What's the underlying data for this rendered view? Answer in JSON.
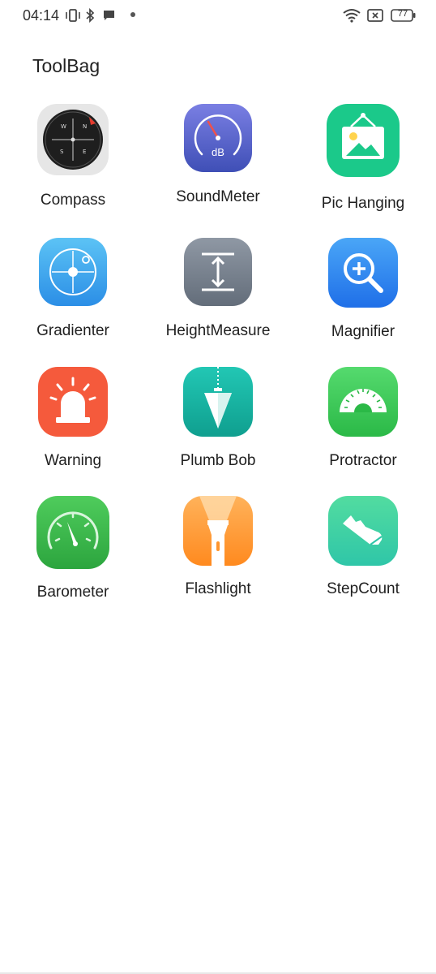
{
  "status_bar": {
    "time": "04:14",
    "battery": "77"
  },
  "page": {
    "title": "ToolBag"
  },
  "apps": [
    {
      "label": "Compass",
      "icon": "compass-icon"
    },
    {
      "label": "SoundMeter",
      "icon": "sound-meter-icon"
    },
    {
      "label": "Pic Hanging",
      "icon": "picture-frame-icon"
    },
    {
      "label": "Gradienter",
      "icon": "level-target-icon"
    },
    {
      "label": "HeightMeasure",
      "icon": "height-arrows-icon"
    },
    {
      "label": "Magnifier",
      "icon": "magnifier-icon"
    },
    {
      "label": "Warning",
      "icon": "siren-icon"
    },
    {
      "label": "Plumb Bob",
      "icon": "plumb-bob-icon"
    },
    {
      "label": "Protractor",
      "icon": "protractor-icon"
    },
    {
      "label": "Barometer",
      "icon": "gauge-icon"
    },
    {
      "label": "Flashlight",
      "icon": "flashlight-icon"
    },
    {
      "label": "StepCount",
      "icon": "shoe-icon"
    }
  ],
  "icon_text": {
    "db": "dB",
    "n": "N",
    "s": "S",
    "e": "E",
    "w": "W"
  },
  "colors": {
    "compass_bg": "#e6e6e6",
    "soundmeter": "#5b62c9",
    "pic_hanging": "#1bc98a",
    "gradienter": "#3aa8ef",
    "height_measure": "#7b8592",
    "magnifier": "#2d86f0",
    "warning": "#f55a3c",
    "plumb_bob": "#14b3a3",
    "protractor": "#3ccf5a",
    "barometer": "#3cb94f",
    "flashlight": "#ff962e",
    "stepcount": "#3fd39e"
  }
}
